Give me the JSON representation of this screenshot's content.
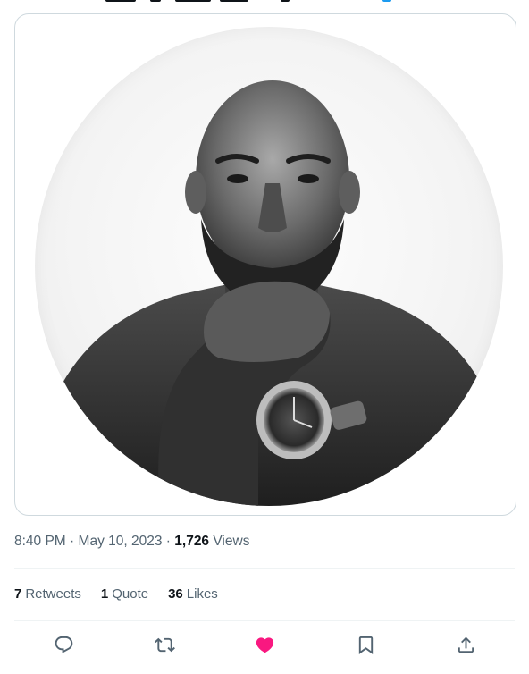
{
  "tweet": {
    "time": "8:40 PM",
    "date": "May 10, 2023",
    "separator": "·",
    "views_count": "1,726",
    "views_label": "Views"
  },
  "stats": {
    "retweets_count": "7",
    "retweets_label": "Retweets",
    "quotes_count": "1",
    "quotes_label": "Quote",
    "likes_count": "36",
    "likes_label": "Likes"
  },
  "actions": {
    "reply_icon": "speech-bubble",
    "retweet_icon": "repost-arrows",
    "like_icon": "heart-filled",
    "bookmark_icon": "bookmark",
    "share_icon": "share-upload",
    "like_active": true
  },
  "colors": {
    "text_primary": "#0f1419",
    "text_secondary": "#536471",
    "like_active": "#f91880",
    "accent": "#1d9bf0",
    "border": "#cfd9de",
    "divider": "#eff3f4"
  }
}
